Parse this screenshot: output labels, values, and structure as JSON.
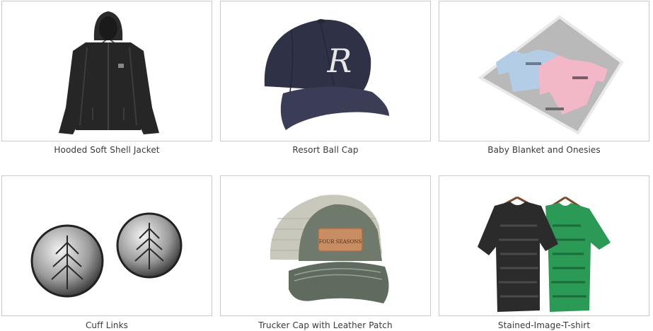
{
  "products": [
    {
      "label": "Hooded Soft Shell Jacket",
      "image_icon": "jacket-image"
    },
    {
      "label": "Resort Ball Cap",
      "image_icon": "ball-cap-image"
    },
    {
      "label": "Baby Blanket and Onesies",
      "image_icon": "baby-blanket-image"
    },
    {
      "label": "Cuff Links",
      "image_icon": "cuff-links-image"
    },
    {
      "label": "Trucker Cap with Leather Patch",
      "image_icon": "trucker-cap-image"
    },
    {
      "label": "Stained-Image-T-shirt",
      "image_icon": "tshirts-image"
    }
  ],
  "product_images_text": {
    "ball_cap_monogram": "R",
    "trucker_patch": "FOUR SEASONS"
  }
}
